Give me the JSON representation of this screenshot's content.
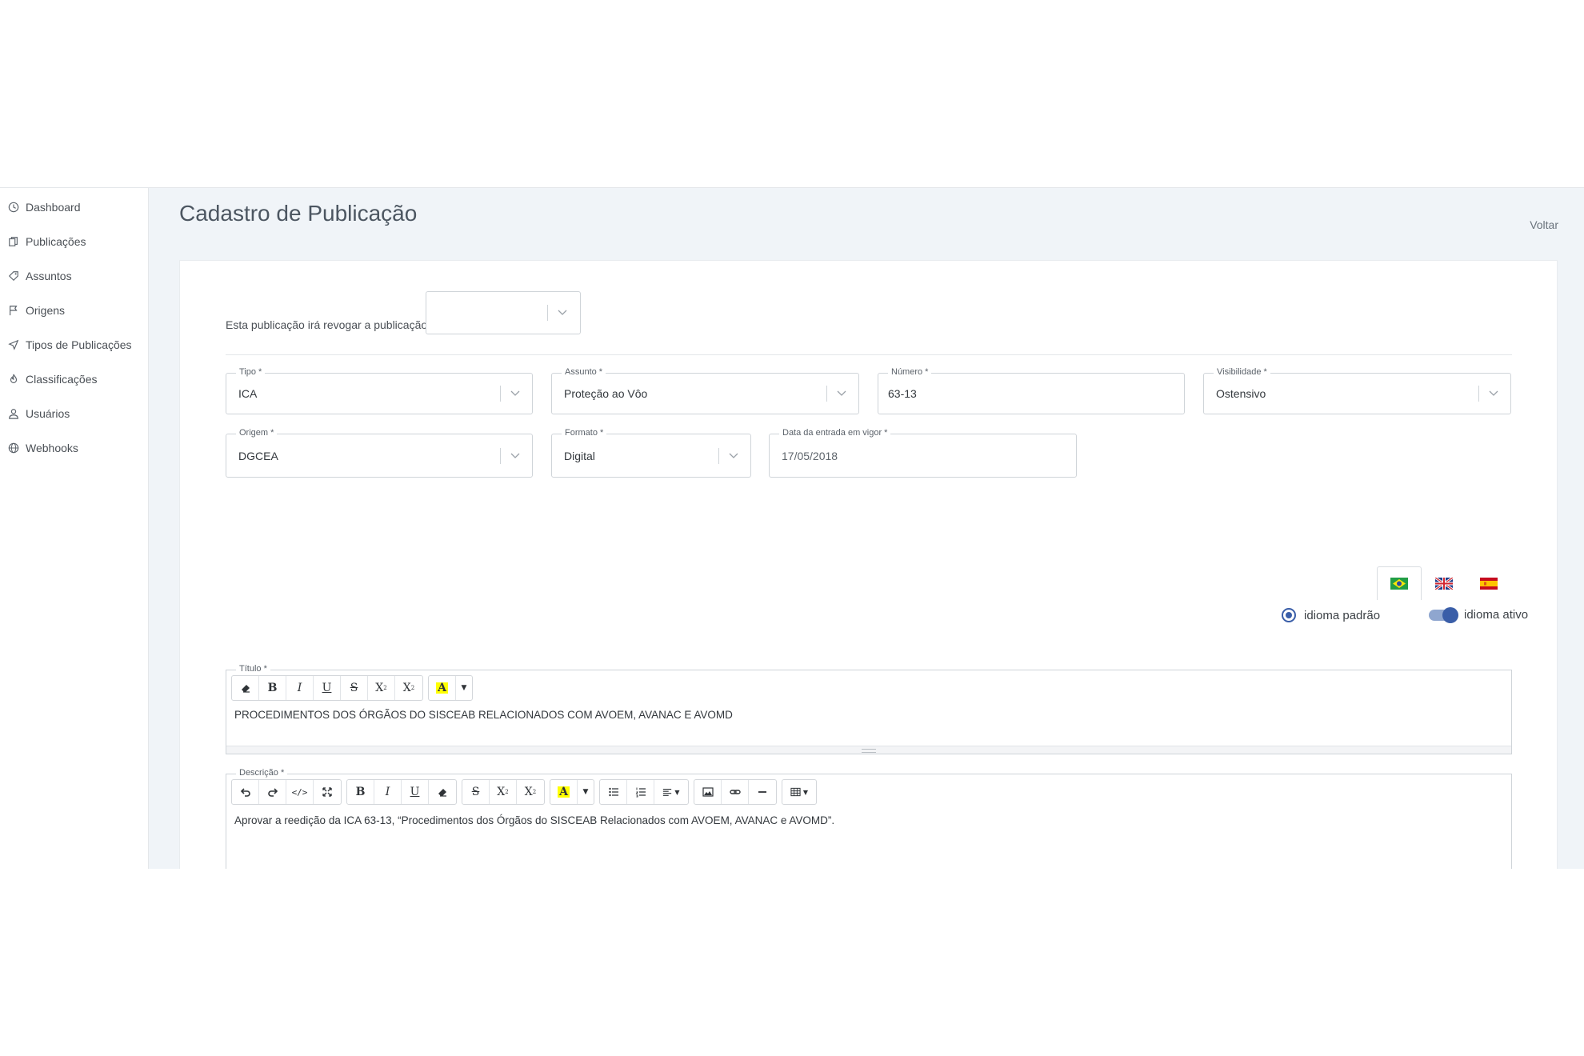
{
  "sidebar": {
    "items": [
      {
        "label": "Dashboard",
        "icon": "clock-icon"
      },
      {
        "label": "Publicações",
        "icon": "documents-icon"
      },
      {
        "label": "Assuntos",
        "icon": "tag-icon"
      },
      {
        "label": "Origens",
        "icon": "flag-icon"
      },
      {
        "label": "Tipos de Publicações",
        "icon": "send-icon"
      },
      {
        "label": "Classificações",
        "icon": "flame-icon"
      },
      {
        "label": "Usuários",
        "icon": "user-icon"
      },
      {
        "label": "Webhooks",
        "icon": "globe-icon"
      }
    ]
  },
  "header": {
    "title": "Cadastro de Publicação",
    "back_label": "Voltar"
  },
  "form": {
    "revoke_label": "Esta publicação irá revogar a publicação",
    "revoke_value": "",
    "tipo": {
      "label": "Tipo *",
      "value": "ICA"
    },
    "assunto": {
      "label": "Assunto *",
      "value": "Proteção ao Vôo"
    },
    "numero": {
      "label": "Número *",
      "value": "63-13"
    },
    "visibilidade": {
      "label": "Visibilidade *",
      "value": "Ostensivo"
    },
    "origem": {
      "label": "Origem *",
      "value": "DGCEA"
    },
    "formato": {
      "label": "Formato *",
      "value": "Digital"
    },
    "data_vigor": {
      "label": "Data da entrada em vigor *",
      "value": "17/05/2018"
    }
  },
  "languages": {
    "tabs": [
      {
        "name": "pt-br",
        "icon": "brazil-flag-icon",
        "active": true
      },
      {
        "name": "en",
        "icon": "uk-flag-icon",
        "active": false
      },
      {
        "name": "es",
        "icon": "spain-flag-icon",
        "active": false
      }
    ],
    "default_label": "idioma padrão",
    "active_label": "idioma ativo"
  },
  "titulo_editor": {
    "label": "Título *",
    "content": "PROCEDIMENTOS DOS ÓRGÃOS DO SISCEAB RELACIONADOS COM AVOEM, AVANAC E AVOMD"
  },
  "descricao_editor": {
    "label": "Descrição *",
    "content": "Aprovar a reedição da ICA 63-13, “Procedimentos dos Órgãos do SISCEAB Relacionados com AVOEM, AVANAC e AVOMD”."
  },
  "colors": {
    "accent": "#3a5ea8",
    "highlight": "#ffff00",
    "background": "#f0f4f8"
  }
}
